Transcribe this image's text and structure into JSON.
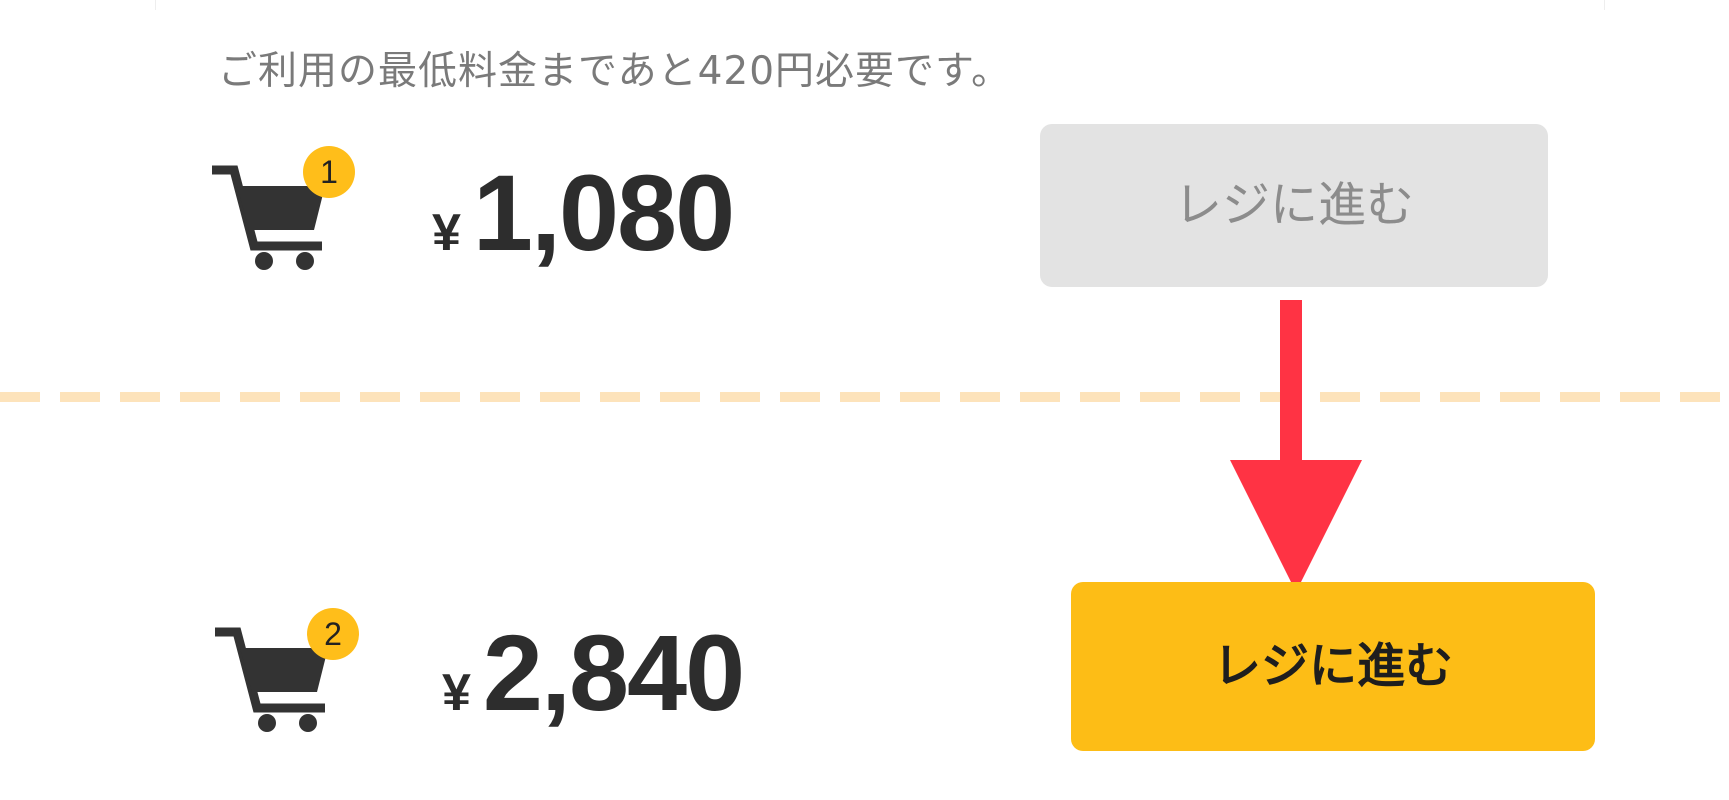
{
  "notice": {
    "text": "ご利用の最低料金まであと420円必要です。"
  },
  "before": {
    "cart_count": "1",
    "currency_symbol": "¥",
    "amount": "1,080",
    "button_label": "レジに進む",
    "button_state": "disabled"
  },
  "after": {
    "cart_count": "2",
    "currency_symbol": "¥",
    "amount": "2,840",
    "button_label": "レジに進む",
    "button_state": "enabled"
  },
  "icons": {
    "cart": "shopping-cart-icon",
    "arrow": "arrow-down-icon"
  },
  "colors": {
    "badge": "#ffbe1a",
    "button_active": "#fdbd16",
    "button_disabled": "#e3e3e3",
    "arrow": "#ff3344",
    "divider": "#fde3bb",
    "text_dark": "#2d2d2d",
    "text_muted": "#7a7a7a"
  }
}
